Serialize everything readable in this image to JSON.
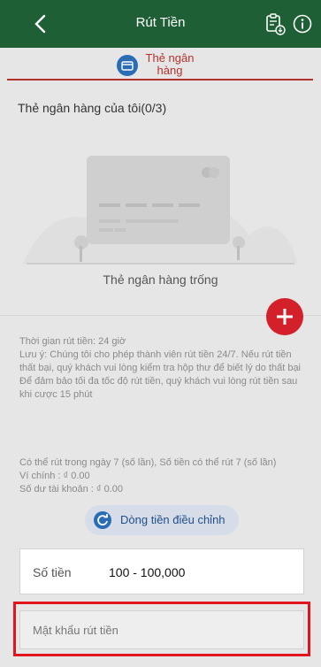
{
  "header": {
    "title": "Rút Tiền",
    "back_icon": "chevron-left-icon",
    "clipboard_icon": "clipboard-download-icon",
    "info_icon": "info-icon",
    "color": "#1f5f35"
  },
  "tabs": [
    {
      "label": "Thẻ ngân hàng",
      "icon": "bank-card-icon",
      "active": true,
      "accent": "#b3322d"
    }
  ],
  "bank_section": {
    "title": "Thẻ ngân hàng của tôi(0/3)",
    "empty_text": "Thẻ ngân hàng trống",
    "add_icon": "plus-icon",
    "add_color": "#d3202b"
  },
  "notes": {
    "time": "Thời gian rút tiền:   24 giờ",
    "note1": "Lưu ý:  Chúng tôi cho phép thành viên rút tiền 24/7. Nếu rút tiền thất bại, quý khách vui lòng kiểm tra hộp thư để biết lý do thất bại",
    "note2": "Để đảm bảo tối đa tốc độ rút tiền, quý khách vui lòng rút tiền sau khi cược 15 phút"
  },
  "stats": {
    "line1": "Có thể rút trong ngày 7 (số lần), Số tiền có thể rút 7 (số lần)",
    "line2": "Ví chính : ₫ 0.00",
    "line3": "Số dư tài khoản : ₫ 0.00"
  },
  "adjust_button": {
    "label": "Dòng tiền điều chỉnh",
    "icon": "refresh-icon"
  },
  "amount": {
    "label": "Số tiền",
    "value": "100 - 100,000"
  },
  "password": {
    "placeholder": "Mật khẩu rút tiền",
    "highlight": "#e2141e"
  }
}
